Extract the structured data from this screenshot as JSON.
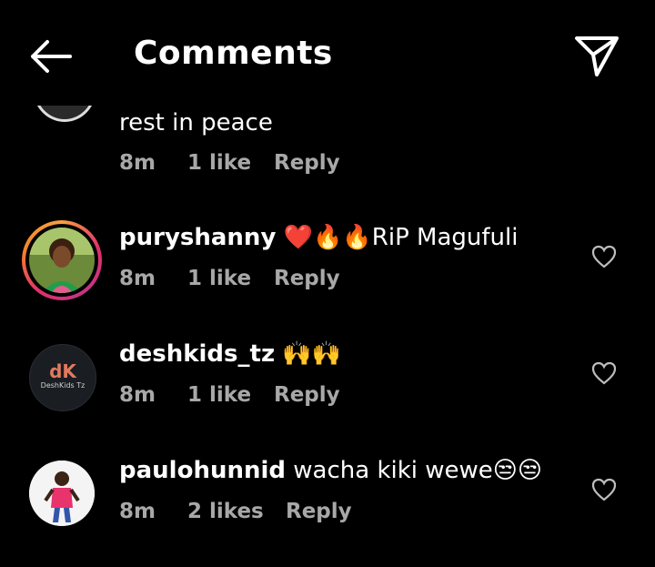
{
  "header": {
    "title": "Comments",
    "back_icon": "arrow-left-icon",
    "send_icon": "paper-plane-icon"
  },
  "comments": [
    {
      "username": "",
      "text": "rest in peace",
      "time": "8m",
      "likes": "1 like",
      "reply": "Reply"
    },
    {
      "username": "puryshanny",
      "text": "❤️🔥🔥RiP Magufuli",
      "time": "8m",
      "likes": "1 like",
      "reply": "Reply",
      "has_story": true
    },
    {
      "username": "deshkids_tz",
      "text": "🙌🙌",
      "time": "8m",
      "likes": "1 like",
      "reply": "Reply",
      "avatar_logo_text": "DeshKids Tz"
    },
    {
      "username": "paulohunnid",
      "text": "wacha kiki wewe😒😒",
      "time": "8m",
      "likes": "2 likes",
      "reply": "Reply"
    }
  ],
  "colors": {
    "background": "#000000",
    "text_primary": "#ffffff",
    "text_secondary": "#a8a8a8",
    "heart_emoji": "#e0245e",
    "fire_emoji": "#ff7a00"
  }
}
